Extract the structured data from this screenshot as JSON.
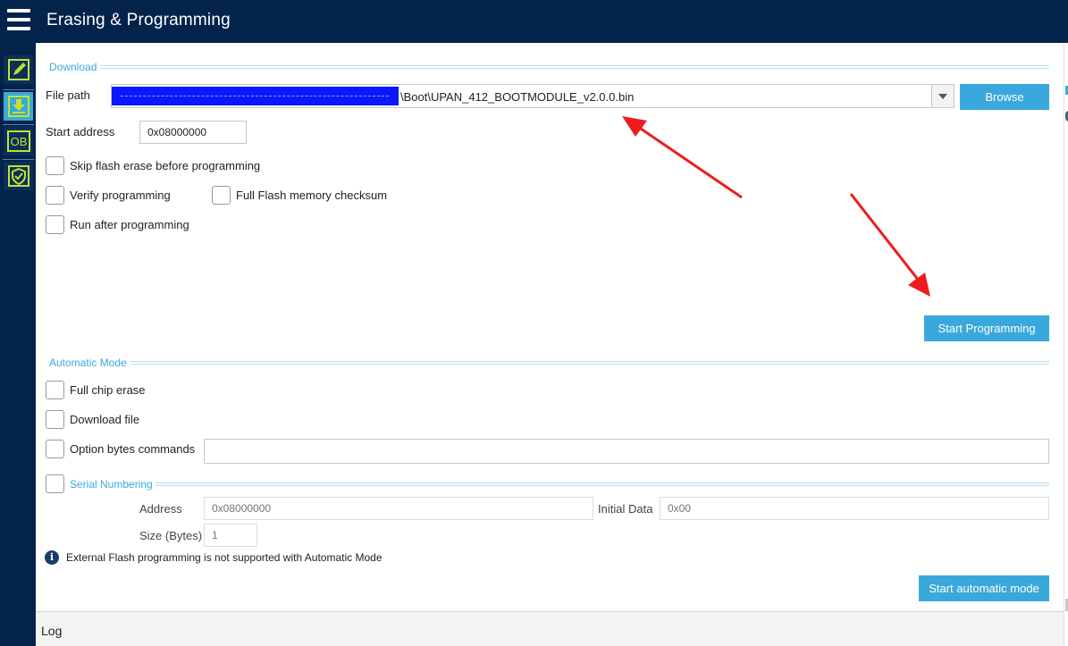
{
  "app": {
    "title": "Erasing & Programming"
  },
  "sidebar": {
    "items": [
      {
        "id": "memory",
        "icon": "pencil-edit-icon"
      },
      {
        "id": "erasing-programming",
        "icon": "download-icon",
        "active": true
      },
      {
        "id": "option-bytes",
        "icon": "ob-icon",
        "label": "OB"
      },
      {
        "id": "security",
        "icon": "shield-icon"
      }
    ]
  },
  "download": {
    "section_title": "Download",
    "file_path_label": "File path",
    "file_path_value": "\\Boot\\UPAN_412_BOOTMODULE_v2.0.0.bin",
    "browse_label": "Browse",
    "start_address_label": "Start address",
    "start_address_value": "0x08000000",
    "skip_erase_label": "Skip flash erase before programming",
    "verify_label": "Verify programming",
    "full_checksum_label": "Full Flash memory checksum",
    "run_after_label": "Run after programming",
    "start_programming_label": "Start Programming"
  },
  "automatic": {
    "section_title": "Automatic Mode",
    "full_chip_erase_label": "Full chip erase",
    "download_file_label": "Download file",
    "option_bytes_label": "Option bytes commands",
    "option_bytes_value": "",
    "serial_numbering_label": "Serial Numbering",
    "address_label": "Address",
    "address_placeholder": "0x08000000",
    "initial_data_label": "Initial Data",
    "initial_data_placeholder": "0x00",
    "size_label": "Size (Bytes)",
    "size_placeholder": "1",
    "info_text": "External Flash programming is not supported with Automatic Mode",
    "start_auto_label": "Start automatic mode"
  },
  "log": {
    "label": "Log"
  },
  "colors": {
    "nav_bg": "#03234b",
    "accent": "#3aa8dc",
    "redaction": "#0b17ff",
    "annotation_arrow": "#ee1c1c"
  }
}
